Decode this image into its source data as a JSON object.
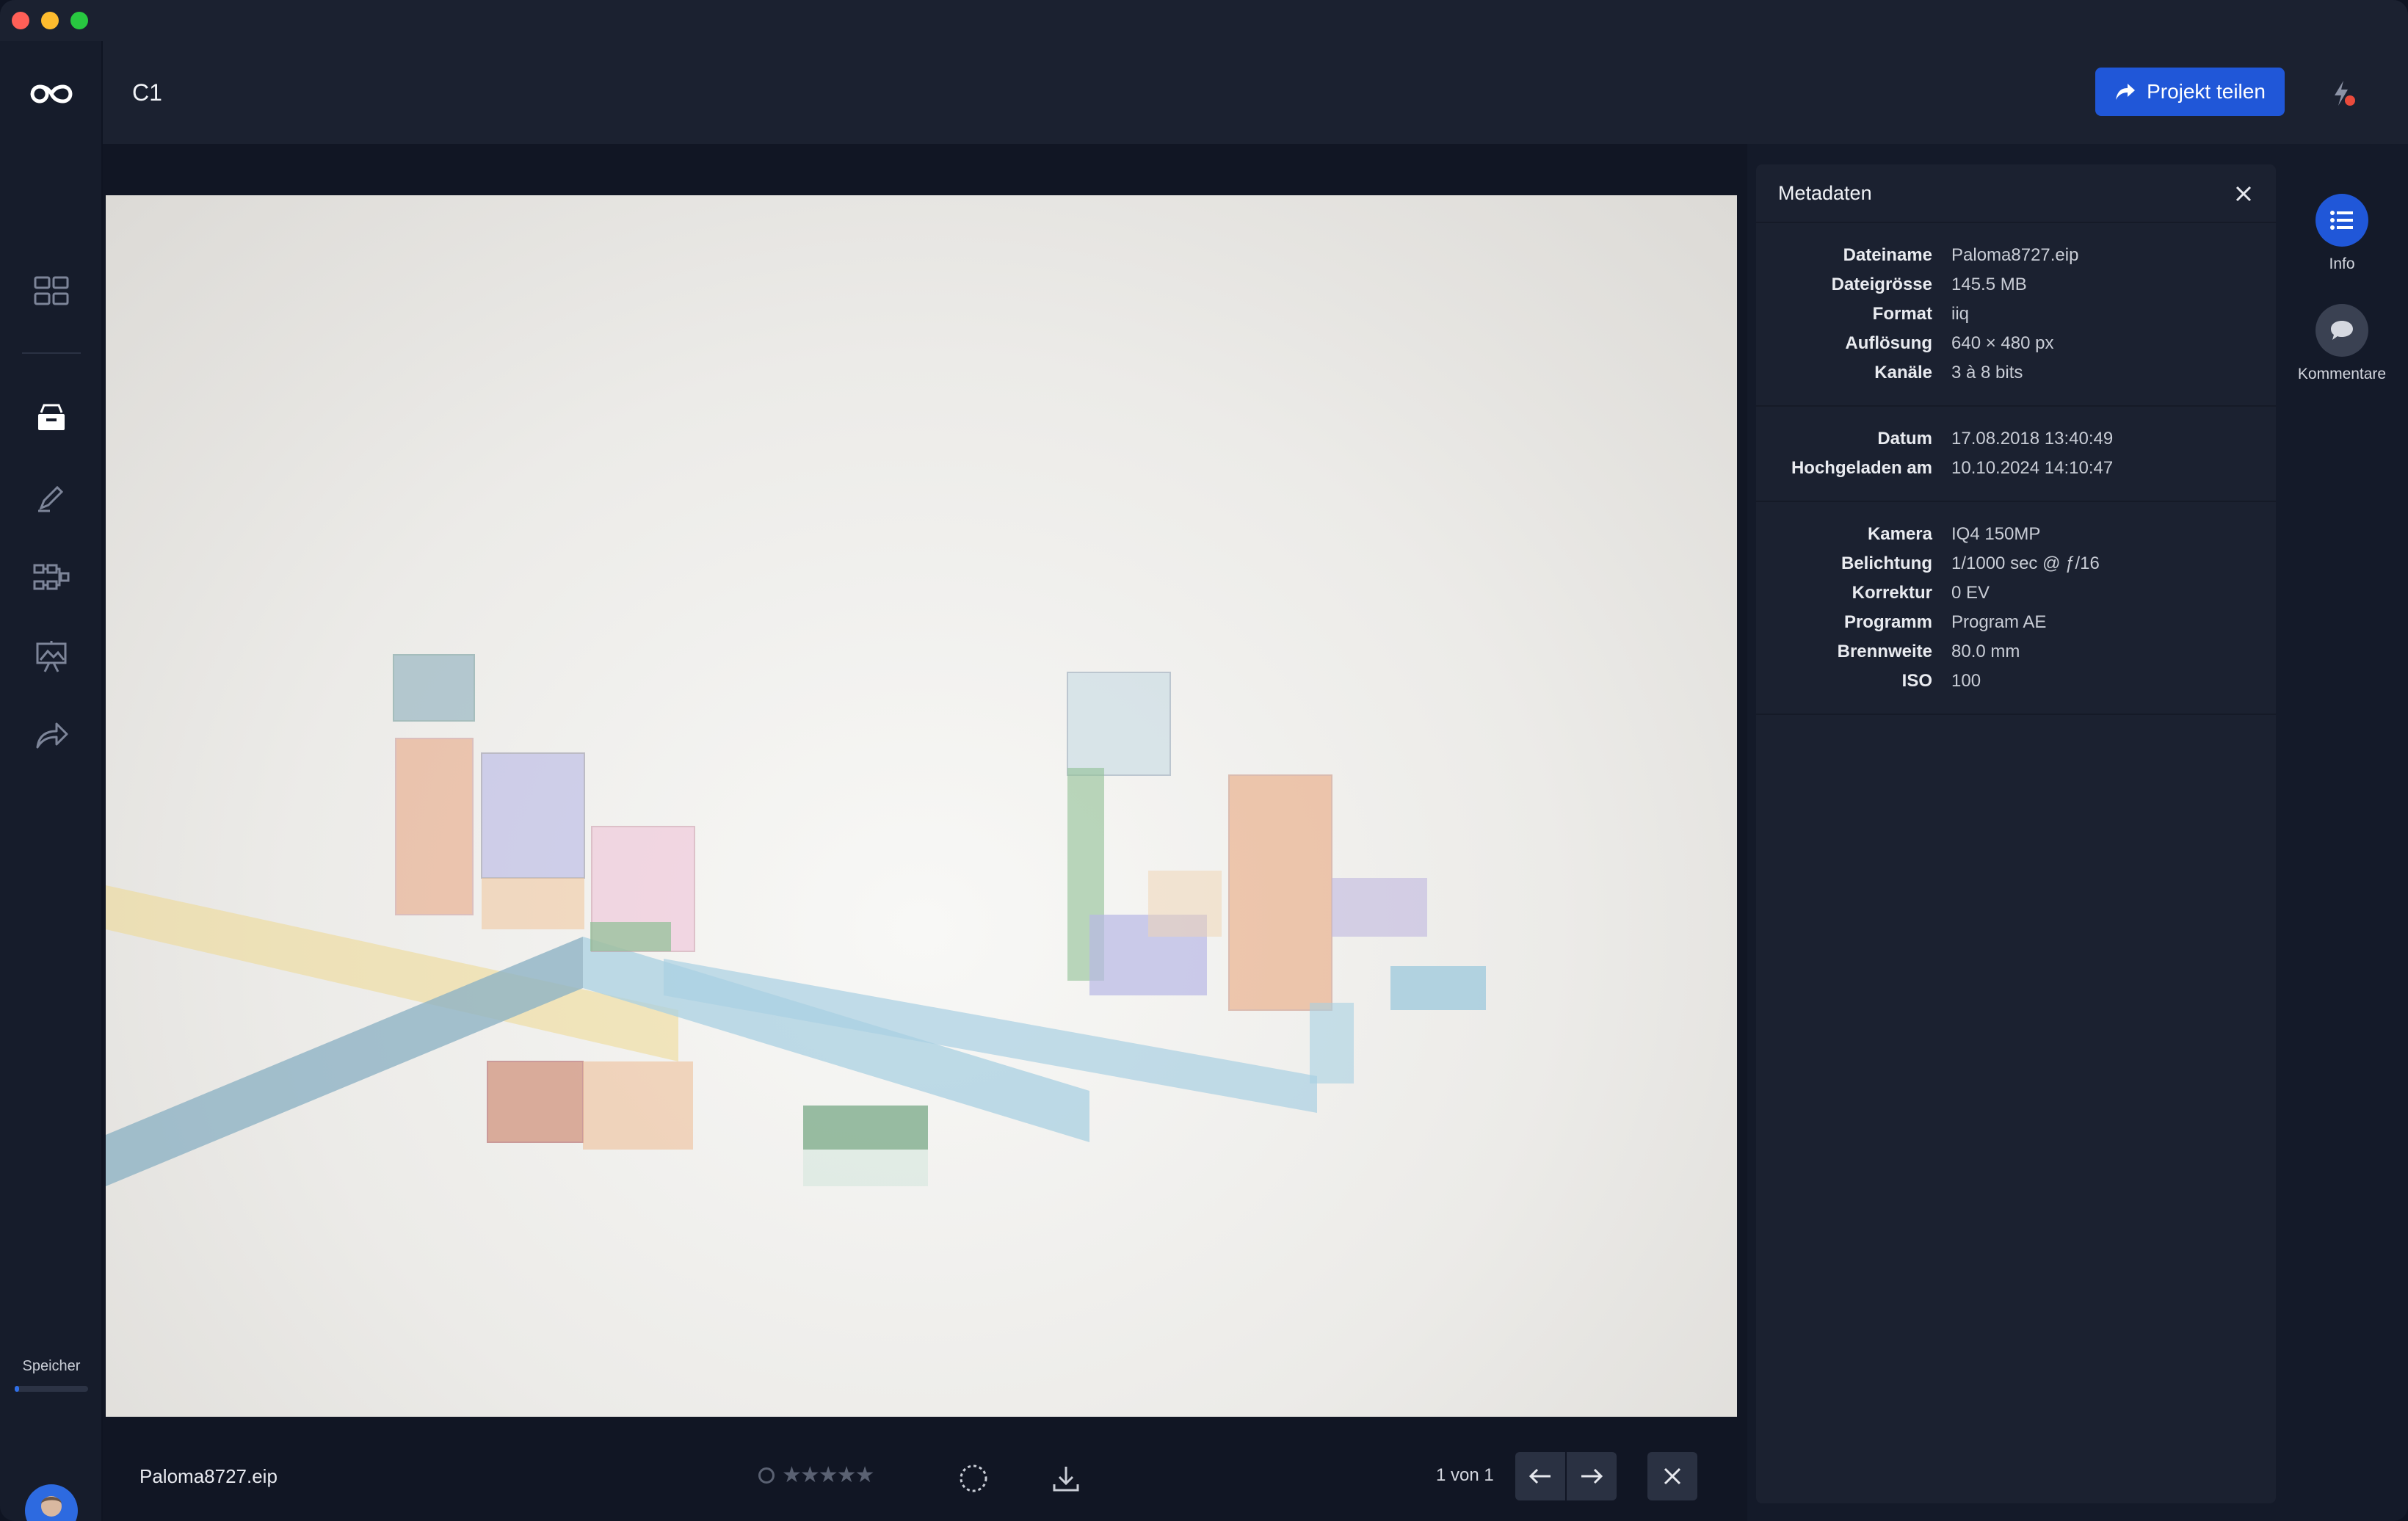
{
  "window": {
    "title_bar_buttons": [
      "close",
      "minimize",
      "zoom"
    ]
  },
  "sidebar": {
    "items": [
      {
        "name": "grid-view",
        "icon": "grid-icon"
      },
      {
        "name": "archive",
        "icon": "archive-box-icon"
      },
      {
        "name": "markup",
        "icon": "pen-icon"
      },
      {
        "name": "workflow",
        "icon": "workflow-icon"
      },
      {
        "name": "presentation",
        "icon": "easel-icon"
      },
      {
        "name": "share",
        "icon": "share-arrow-icon"
      }
    ],
    "storage_label": "Speicher",
    "storage_used_fraction": 0.06
  },
  "header": {
    "project_title": "C1",
    "share_label": "Projekt teilen",
    "notifications_icon": "bolt-icon"
  },
  "viewer": {
    "filename": "Paloma8727.eip",
    "rating_stars": "★★★★★",
    "rating_value": 0,
    "pager": "1 von 1"
  },
  "metadata": {
    "title": "Metadaten",
    "groups": [
      [
        {
          "label": "Dateiname",
          "value": "Paloma8727.eip"
        },
        {
          "label": "Dateigrösse",
          "value": "145.5 MB"
        },
        {
          "label": "Format",
          "value": "iiq"
        },
        {
          "label": "Auflösung",
          "value": "640 × 480 px"
        },
        {
          "label": "Kanäle",
          "value": "3 à 8 bits"
        }
      ],
      [
        {
          "label": "Datum",
          "value": "17.08.2018 13:40:49"
        },
        {
          "label": "Hochgeladen am",
          "value": "10.10.2024 14:10:47"
        }
      ],
      [
        {
          "label": "Kamera",
          "value": "IQ4 150MP"
        },
        {
          "label": "Belichtung",
          "value": "1/1000 sec @ ƒ/16"
        },
        {
          "label": "Korrektur",
          "value": "0 EV"
        },
        {
          "label": "Programm",
          "value": "Program AE"
        },
        {
          "label": "Brennweite",
          "value": "80.0 mm"
        },
        {
          "label": "ISO",
          "value": "100"
        }
      ]
    ]
  },
  "right_rail": {
    "info_label": "Info",
    "comments_label": "Kommentare"
  },
  "colors": {
    "accent": "#2057d8",
    "background": "#141a29",
    "panel": "#1b2130",
    "notification": "#ea4b3c"
  }
}
